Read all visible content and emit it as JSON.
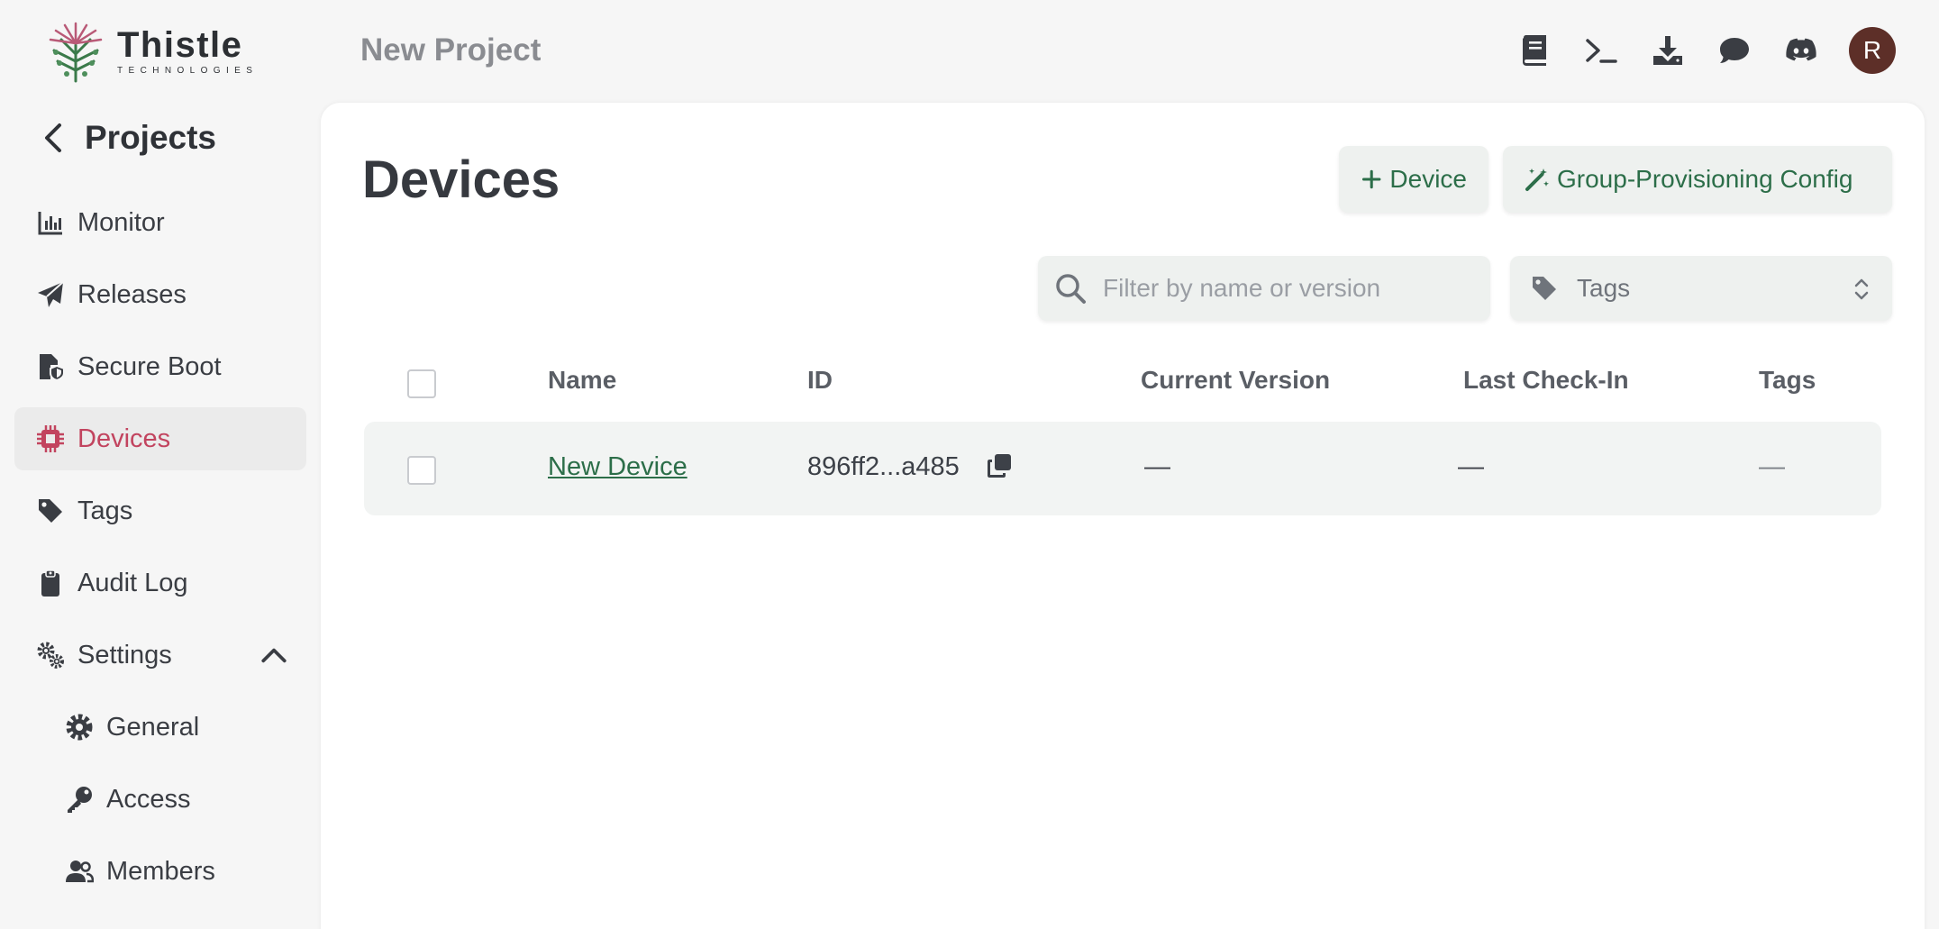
{
  "brand": {
    "name": "Thistle",
    "subtitle": "TECHNOLOGIES"
  },
  "sidebar": {
    "back_label": "Projects",
    "items": [
      {
        "label": "Monitor",
        "icon": "chart-icon"
      },
      {
        "label": "Releases",
        "icon": "paper-plane-icon"
      },
      {
        "label": "Secure Boot",
        "icon": "file-shield-icon"
      },
      {
        "label": "Devices",
        "icon": "chip-icon",
        "active": true
      },
      {
        "label": "Tags",
        "icon": "tag-icon"
      },
      {
        "label": "Audit Log",
        "icon": "clipboard-icon"
      },
      {
        "label": "Settings",
        "icon": "gears-icon",
        "expanded": true
      }
    ],
    "settings_items": [
      {
        "label": "General",
        "icon": "gear-icon"
      },
      {
        "label": "Access",
        "icon": "key-icon"
      },
      {
        "label": "Members",
        "icon": "users-icon"
      }
    ]
  },
  "header": {
    "project_title": "New Project",
    "icons": [
      "book-icon",
      "terminal-icon",
      "download-icon",
      "chat-icon",
      "discord-icon"
    ],
    "avatar_initial": "R"
  },
  "main": {
    "title": "Devices",
    "add_device_label": "Device",
    "group_config_label": "Group-Provisioning Config",
    "search_placeholder": "Filter by name or version",
    "tags_select_value": "Tags",
    "columns": [
      "Name",
      "ID",
      "Current Version",
      "Last Check-In",
      "Tags"
    ],
    "rows": [
      {
        "name": "New Device",
        "id": "896ff2...a485",
        "current_version": "—",
        "last_checkin": "—",
        "tags": "—"
      }
    ]
  },
  "colors": {
    "accent_green": "#2c6e49",
    "active_pink": "#c2445f",
    "avatar": "#5d2f28"
  }
}
